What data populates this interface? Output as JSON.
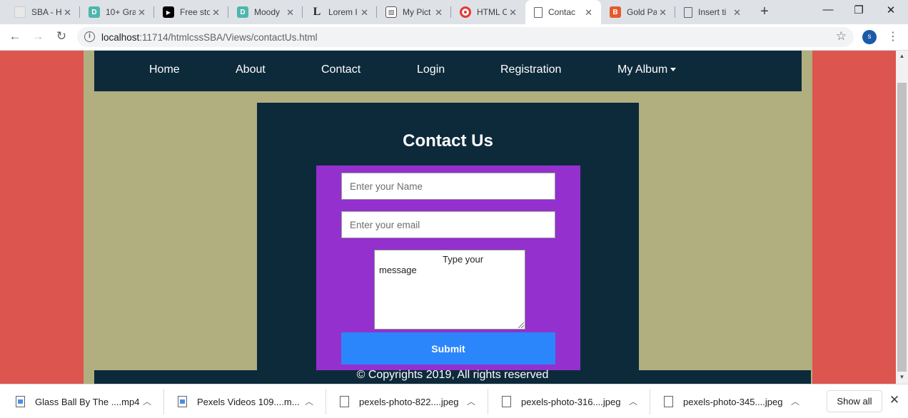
{
  "browser": {
    "tabs": [
      {
        "title": "SBA - H",
        "favicon": "page-thumb-icon",
        "color": "#e8e8e8"
      },
      {
        "title": "10+ Gra",
        "favicon": "p-letter-icon",
        "color": "#4db6ac"
      },
      {
        "title": "Free sto",
        "favicon": "play-icon",
        "color": "#000000"
      },
      {
        "title": "Moody",
        "favicon": "p-letter-icon",
        "color": "#4db6ac"
      },
      {
        "title": "Lorem I",
        "favicon": "l-letter-icon",
        "color": "#ffffff"
      },
      {
        "title": "My Pict",
        "favicon": "image-icon",
        "color": "#ffffff"
      },
      {
        "title": "HTML C",
        "favicon": "opera-icon",
        "color": "#e53935"
      },
      {
        "title": "Contac",
        "favicon": "document-icon",
        "color": "#ffffff",
        "active": true
      },
      {
        "title": "Gold Pa",
        "favicon": "b-letter-icon",
        "color": "#e45a2b"
      },
      {
        "title": "Insert ti",
        "favicon": "document-icon",
        "color": "#ffffff"
      }
    ],
    "new_tab": "+",
    "minimize": "—",
    "restore": "❐",
    "close": "✕",
    "nav": {
      "back": "←",
      "forward": "→",
      "reload": "↻"
    },
    "url_host": "localhost",
    "url_path": ":11714/htmlcssSBA/Views/contactUs.html",
    "bookmark_star": "☆",
    "profile_initial": "s",
    "menu": "⋮"
  },
  "page": {
    "nav_items": [
      "Home",
      "About",
      "Contact",
      "Login",
      "Registration",
      "My Album"
    ],
    "heading": "Contact Us",
    "form": {
      "name_placeholder": "Enter your Name",
      "email_placeholder": "Enter your email",
      "message_line1": "Type your",
      "message_line2": "message",
      "submit_label": "Submit"
    },
    "footer": "© Copyrights 2019, All rights reserved",
    "colors": {
      "page_bg": "#dc554f",
      "wrapper_bg": "#b1af7f",
      "nav_bg": "#0d2a3b",
      "form_bg": "#9330ce",
      "submit_bg": "#2b86fb"
    }
  },
  "downloads": {
    "items": [
      {
        "name": "Glass Ball By The ....mp4",
        "icon": "video-file-icon"
      },
      {
        "name": "Pexels Videos 109....m...",
        "icon": "video-file-icon"
      },
      {
        "name": "pexels-photo-822....jpeg",
        "icon": "image-file-icon"
      },
      {
        "name": "pexels-photo-316....jpeg",
        "icon": "image-file-icon"
      },
      {
        "name": "pexels-photo-345....jpeg",
        "icon": "image-file-icon"
      }
    ],
    "show_all": "Show all",
    "close": "✕"
  }
}
